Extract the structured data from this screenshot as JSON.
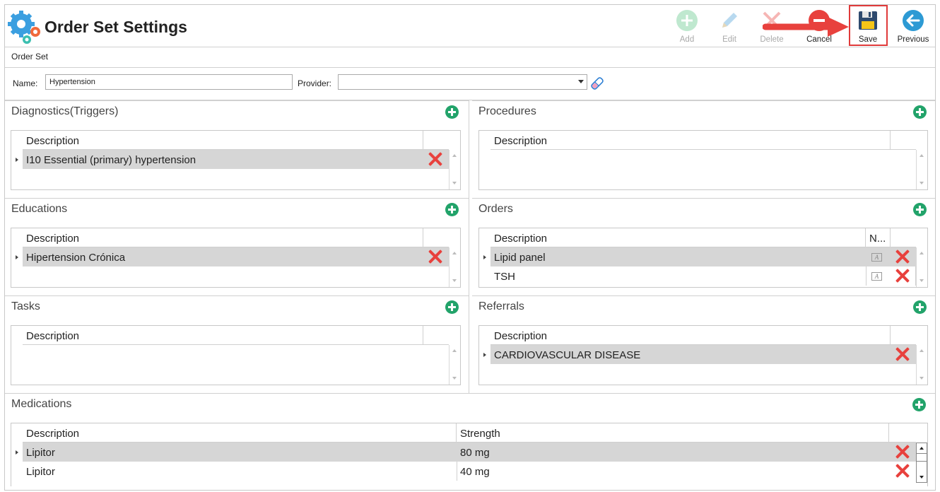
{
  "header": {
    "title": "Order Set Settings",
    "toolbar": {
      "add": "Add",
      "edit": "Edit",
      "delete": "Delete",
      "cancel": "Cancel",
      "save": "Save",
      "previous": "Previous"
    }
  },
  "order_set": {
    "section_label": "Order Set",
    "name_label": "Name:",
    "name_value": "Hypertension",
    "provider_label": "Provider:",
    "provider_value": ""
  },
  "panels": {
    "diagnostics": {
      "title": "Diagnostics(Triggers)",
      "columns": [
        "Description"
      ],
      "rows": [
        {
          "description": "I10 Essential (primary) hypertension"
        }
      ]
    },
    "procedures": {
      "title": "Procedures",
      "columns": [
        "Description"
      ],
      "rows": []
    },
    "educations": {
      "title": "Educations",
      "columns": [
        "Description"
      ],
      "rows": [
        {
          "description": "Hipertension Crónica"
        }
      ]
    },
    "orders": {
      "title": "Orders",
      "columns": [
        "Description",
        "N..."
      ],
      "rows": [
        {
          "description": "Lipid panel"
        },
        {
          "description": "TSH"
        }
      ]
    },
    "tasks": {
      "title": "Tasks",
      "columns": [
        "Description"
      ],
      "rows": []
    },
    "referrals": {
      "title": "Referrals",
      "columns": [
        "Description"
      ],
      "rows": [
        {
          "description": "CARDIOVASCULAR DISEASE"
        }
      ]
    },
    "medications": {
      "title": "Medications",
      "columns": [
        "Description",
        "Strength"
      ],
      "rows": [
        {
          "description": "Lipitor",
          "strength": "80 mg"
        },
        {
          "description": "Lipitor",
          "strength": "40 mg"
        }
      ]
    }
  },
  "colors": {
    "add_green": "#22a36a",
    "delete_red": "#e8413d",
    "selected_row": "#d6d6d6",
    "highlight_red": "#e03a3a"
  }
}
